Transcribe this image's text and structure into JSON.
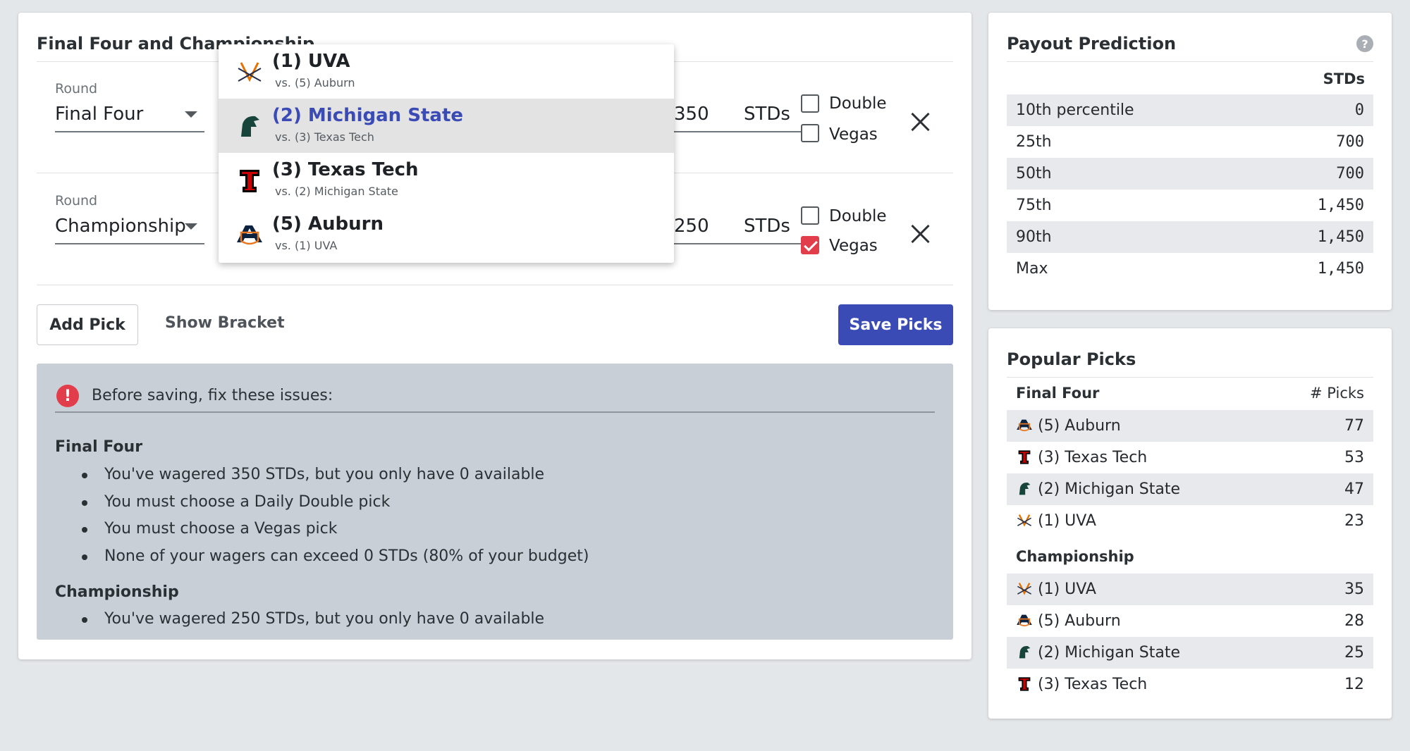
{
  "main": {
    "title": "Final Four and Championship",
    "rows": [
      {
        "round_label": "Round",
        "round_value": "Final Four",
        "wager_value": "350",
        "unit": "STDs",
        "double_label": "Double",
        "double_checked": false,
        "vegas_label": "Vegas",
        "vegas_checked": false
      },
      {
        "round_label": "Round",
        "round_value": "Championship",
        "wager_value": "250",
        "unit": "STDs",
        "double_label": "Double",
        "double_checked": false,
        "vegas_label": "Vegas",
        "vegas_checked": true
      }
    ],
    "add_pick": "Add Pick",
    "show_bracket": "Show Bracket",
    "save_picks": "Save Picks"
  },
  "dropdown": {
    "items": [
      {
        "name": "(1) UVA",
        "sub": "vs. (5) Auburn",
        "logo": "uva-logo",
        "active": false
      },
      {
        "name": "(2) Michigan State",
        "sub": "vs. (3) Texas Tech",
        "logo": "michigan-state-logo",
        "active": true
      },
      {
        "name": "(3) Texas Tech",
        "sub": "vs. (2) Michigan State",
        "logo": "texas-tech-logo",
        "active": false
      },
      {
        "name": "(5) Auburn",
        "sub": "vs. (1) UVA",
        "logo": "auburn-logo",
        "active": false
      }
    ]
  },
  "errors": {
    "icon": "!",
    "title": "Before saving, fix these issues:",
    "sections": [
      {
        "heading": "Final Four",
        "items": [
          "You've wagered 350 STDs, but you only have 0 available",
          "You must choose a Daily Double pick",
          "You must choose a Vegas pick",
          "None of your wagers can exceed 0 STDs (80% of your budget)"
        ]
      },
      {
        "heading": "Championship",
        "items": [
          "You've wagered 250 STDs, but you only have 0 available"
        ]
      }
    ]
  },
  "payout": {
    "title": "Payout Prediction",
    "help": "?",
    "column": "STDs",
    "rows": [
      {
        "label": "10th percentile",
        "value": "0"
      },
      {
        "label": "25th",
        "value": "700"
      },
      {
        "label": "50th",
        "value": "700"
      },
      {
        "label": "75th",
        "value": "1,450"
      },
      {
        "label": "90th",
        "value": "1,450"
      },
      {
        "label": "Max",
        "value": "1,450"
      }
    ]
  },
  "popular": {
    "title": "Popular Picks",
    "column": "# Picks",
    "groups": [
      {
        "heading": "Final Four",
        "rows": [
          {
            "logo": "auburn-logo",
            "label": "(5) Auburn",
            "value": "77"
          },
          {
            "logo": "texas-tech-logo",
            "label": "(3) Texas Tech",
            "value": "53"
          },
          {
            "logo": "michigan-state-logo",
            "label": "(2) Michigan State",
            "value": "47"
          },
          {
            "logo": "uva-logo",
            "label": "(1) UVA",
            "value": "23"
          }
        ]
      },
      {
        "heading": "Championship",
        "rows": [
          {
            "logo": "uva-logo",
            "label": "(1) UVA",
            "value": "35"
          },
          {
            "logo": "auburn-logo",
            "label": "(5) Auburn",
            "value": "28"
          },
          {
            "logo": "michigan-state-logo",
            "label": "(2) Michigan State",
            "value": "25"
          },
          {
            "logo": "texas-tech-logo",
            "label": "(3) Texas Tech",
            "value": "12"
          }
        ]
      }
    ]
  },
  "colors": {
    "primary": "#3a4bb5",
    "error": "#e23d4b",
    "error_panel": "#c8cfd6",
    "uva_orange": "#e57200",
    "msu_green": "#18453b",
    "texas_tech_red": "#cc0000",
    "auburn_navy": "#0c2340"
  }
}
